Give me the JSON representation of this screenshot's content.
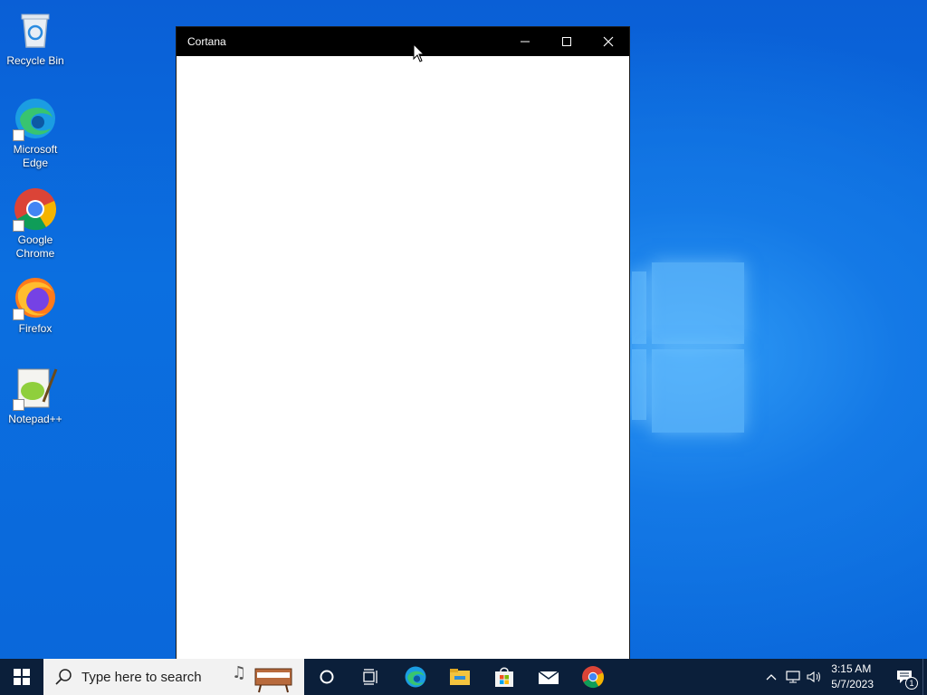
{
  "desktop": {
    "icons": [
      {
        "label": "Recycle Bin",
        "icon": "recycle-bin-icon"
      },
      {
        "label": "Microsoft Edge",
        "icon": "edge-icon"
      },
      {
        "label": "Google Chrome",
        "icon": "chrome-icon"
      },
      {
        "label": "Firefox",
        "icon": "firefox-icon"
      },
      {
        "label": "Notepad++",
        "icon": "notepad-plus-plus-icon"
      }
    ]
  },
  "window": {
    "title": "Cortana",
    "controls": [
      "minimize",
      "maximize",
      "close"
    ]
  },
  "taskbar": {
    "search_placeholder": "Type here to search",
    "apps": [
      "cortana-icon",
      "task-view-icon",
      "edge-icon",
      "file-explorer-icon",
      "microsoft-store-icon",
      "mail-icon",
      "chrome-icon"
    ],
    "tray": {
      "time": "3:15 AM",
      "date": "5/7/2023",
      "notification_count": "1"
    }
  },
  "colors": {
    "taskbar_bg": "#0b1f3a",
    "titlebar_bg": "#000000",
    "desktop_bg": "#0a6fe0"
  }
}
